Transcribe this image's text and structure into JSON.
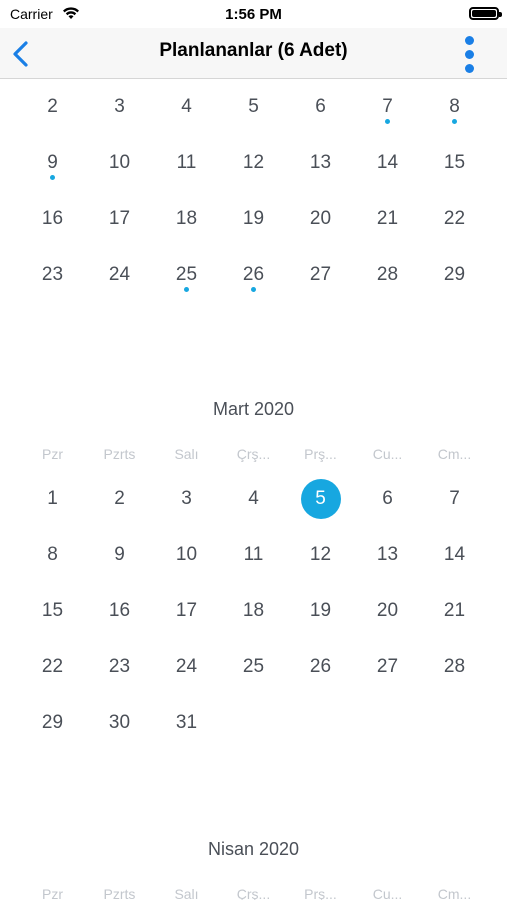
{
  "status": {
    "carrier": "Carrier",
    "time": "1:56 PM"
  },
  "nav": {
    "title": "Planlananlar (6 Adet)"
  },
  "colors": {
    "accent": "#17a7e0",
    "nav_icon": "#1a7fe6"
  },
  "icons": [
    "chevron-left-icon",
    "more-vertical-icon",
    "wifi-icon",
    "battery-icon"
  ],
  "weekdays": [
    "Pzr",
    "Pzrts",
    "Salı",
    "Çrş...",
    "Prş...",
    "Cu...",
    "Cm..."
  ],
  "months": [
    {
      "title": "",
      "show_header": false,
      "first_col": 0,
      "days": [
        2,
        3,
        4,
        5,
        6,
        7,
        8,
        9,
        10,
        11,
        12,
        13,
        14,
        15,
        16,
        17,
        18,
        19,
        20,
        21,
        22,
        23,
        24,
        25,
        26,
        27,
        28,
        29
      ],
      "marked": [
        7,
        8,
        9,
        25,
        26
      ],
      "selected": null
    },
    {
      "title": "Mart 2020",
      "show_header": true,
      "first_col": 0,
      "days": [
        1,
        2,
        3,
        4,
        5,
        6,
        7,
        8,
        9,
        10,
        11,
        12,
        13,
        14,
        15,
        16,
        17,
        18,
        19,
        20,
        21,
        22,
        23,
        24,
        25,
        26,
        27,
        28,
        29,
        30,
        31
      ],
      "marked": [],
      "selected": 5
    },
    {
      "title": "Nisan 2020",
      "show_header": true,
      "first_col": 0,
      "days": [],
      "marked": [],
      "selected": null
    }
  ]
}
